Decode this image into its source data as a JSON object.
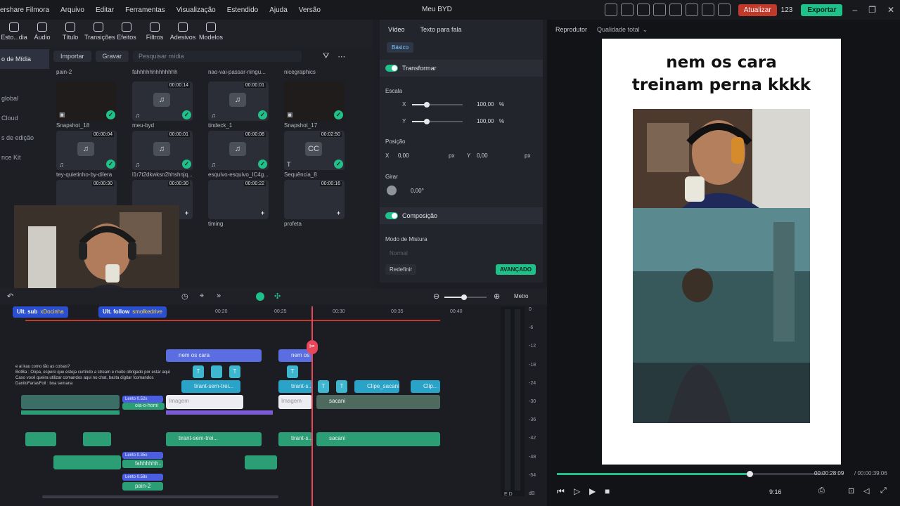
{
  "app": {
    "name": "ershare Filmora",
    "title": "Meu BYD",
    "menus": [
      "Arquivo",
      "Editar",
      "Ferramentas",
      "Visualização",
      "Estendido",
      "Ajuda",
      "Versão"
    ],
    "update": "Atualizar",
    "credits": "123",
    "export": "Exportar"
  },
  "tabs": [
    "Esto...dia",
    "Áudio",
    "Título",
    "Transições",
    "Efeitos",
    "Filtros",
    "Adesivos",
    "Modelos"
  ],
  "sidebar": [
    "o de Mídia",
    "global",
    "Cloud",
    "s de edição",
    "nce Kit"
  ],
  "media_tools": {
    "import": "Importar",
    "record": "Gravar",
    "search_placeholder": "Pesquisar mídia"
  },
  "media_header": [
    "pain-2",
    "fahhhhhhhhhhhhh",
    "nao-vai-passar-ningu...",
    "nicegraphics"
  ],
  "media": [
    {
      "name": "Snapshot_18",
      "dur": "",
      "kind": "▣"
    },
    {
      "name": "meu-byd",
      "dur": "00:00:14",
      "kind": "♫"
    },
    {
      "name": "tindeck_1",
      "dur": "00:00:01",
      "kind": "♫"
    },
    {
      "name": "Snapshot_17",
      "dur": "",
      "kind": "▣"
    },
    {
      "name": "tey-quietinho-by-dilera",
      "dur": "00:00:04",
      "kind": "♫"
    },
    {
      "name": "l1r7t2dkwksn2hhshnjq...",
      "dur": "00:00:01",
      "kind": "♫"
    },
    {
      "name": "esquivo-esquivo_IC4g...",
      "dur": "00:00:08",
      "kind": "♫"
    },
    {
      "name": "Sequência_8",
      "dur": "00:02:50",
      "kind": "T"
    },
    {
      "name": "",
      "dur": "00:00:30",
      "kind": ""
    },
    {
      "name": "",
      "dur": "00:00:30",
      "kind": ""
    },
    {
      "name": "timing",
      "dur": "00:00:22",
      "kind": ""
    },
    {
      "name": "profeta",
      "dur": "00:00:16",
      "kind": ""
    }
  ],
  "props": {
    "tab_video": "Vídeo",
    "tab_tts": "Texto para fala",
    "basic": "Básico",
    "transform": "Transformar",
    "scale": "Escala",
    "x": "X",
    "y": "Y",
    "scale_x": "100,00",
    "scale_y": "100,00",
    "pct": "%",
    "position": "Posição",
    "pos_x": "0,00",
    "pos_y": "0,00",
    "px": "px",
    "rotate": "Girar",
    "rot": "0,00°",
    "composition": "Composição",
    "blend": "Modo de Mistura",
    "blend_val": "Normal",
    "reset": "Redefinir",
    "advanced": "AVANÇADO"
  },
  "player": {
    "label": "Reprodutor",
    "quality": "Qualidade total",
    "caption_line1": "nem os cara",
    "caption_line2": "treinam perna kkkk",
    "time": "00:00:28:09",
    "total": "/ 00:00:39:06",
    "ratio": "9:16",
    "progress": 0.72
  },
  "timeline": {
    "ruler": [
      "00:20",
      "00:25",
      "00:30",
      "00:35",
      "00:40"
    ],
    "meter_label": "Metro",
    "meter": [
      "0",
      "-6",
      "-12",
      "-18",
      "-24",
      "-30",
      "-36",
      "-42",
      "-48",
      "-54",
      "dB"
    ],
    "lr": "E D"
  },
  "clips": {
    "t1": "nem os cara",
    "t2": "nem os",
    "v1": "tirant-sem-trei...",
    "v2": "tirant-s...",
    "v3": "Clipe_sacani",
    "v4": "Clip...",
    "v5": "oia-o-homi",
    "a1": "tirant-sem-trei...",
    "a2": "tirant-s...",
    "a3": "sacani",
    "s1": "Lento 0.52x",
    "s2": "Lento 0.35x",
    "s3": "Lento 0.58x",
    "s4": "pain-2",
    "s5": "fahhhhhh..",
    "img": "Imagem"
  },
  "overlays": {
    "sub": "Ult. sub",
    "sub_name": "xDocinha",
    "follow": "Ult. follow",
    "follow_name": "smolkedrive"
  },
  "chat": [
    "e ai kau como tão as coisas?",
    "BotBa : Oopa, espero que esteja curtindo a stream e muito obrigado por estar aqui Caso você queira utilizar comandos aqui no chat, basta digitar !comandos",
    "DaniloFariasFoil : boa semana"
  ]
}
